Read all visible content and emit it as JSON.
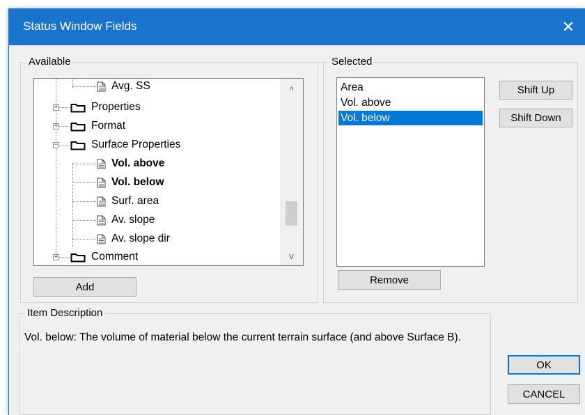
{
  "window": {
    "title": "Status Window Fields",
    "close_glyph": "✕"
  },
  "available": {
    "label": "Available",
    "tree": [
      {
        "label": "Avg. SS",
        "kind": "file",
        "bold": false
      },
      {
        "label": "Properties",
        "kind": "folder",
        "expander": "+"
      },
      {
        "label": "Format",
        "kind": "folder",
        "expander": "+"
      },
      {
        "label": "Surface Properties",
        "kind": "folder",
        "expander": "−"
      },
      {
        "label": "Vol. above",
        "kind": "file",
        "bold": true
      },
      {
        "label": "Vol. below",
        "kind": "file",
        "bold": true
      },
      {
        "label": "Surf. area",
        "kind": "file",
        "bold": false
      },
      {
        "label": "Av. slope",
        "kind": "file",
        "bold": false
      },
      {
        "label": "Av. slope dir",
        "kind": "file",
        "bold": false
      },
      {
        "label": "Comment",
        "kind": "folder",
        "expander": "+"
      }
    ],
    "scroll_up_glyph": "^",
    "scroll_down_glyph": "v",
    "add_label": "Add"
  },
  "selected": {
    "label": "Selected",
    "items": [
      {
        "label": "Area",
        "selected": false
      },
      {
        "label": "Vol. above",
        "selected": false
      },
      {
        "label": "Vol. below",
        "selected": true
      }
    ],
    "shift_up_label": "Shift Up",
    "shift_down_label": "Shift Down",
    "remove_label": "Remove"
  },
  "item_description": {
    "label": "Item Description",
    "text": "Vol. below: The volume of material below the current terrain surface (and above Surface B)."
  },
  "buttons": {
    "ok_label": "OK",
    "cancel_label": "CANCEL"
  },
  "colors": {
    "titlebar": "#1874cd",
    "selection": "#0078d7",
    "dialog_bg": "#f0f0f0"
  },
  "icons": {
    "folder": "folder-icon",
    "file": "document-icon",
    "close": "close-icon"
  }
}
